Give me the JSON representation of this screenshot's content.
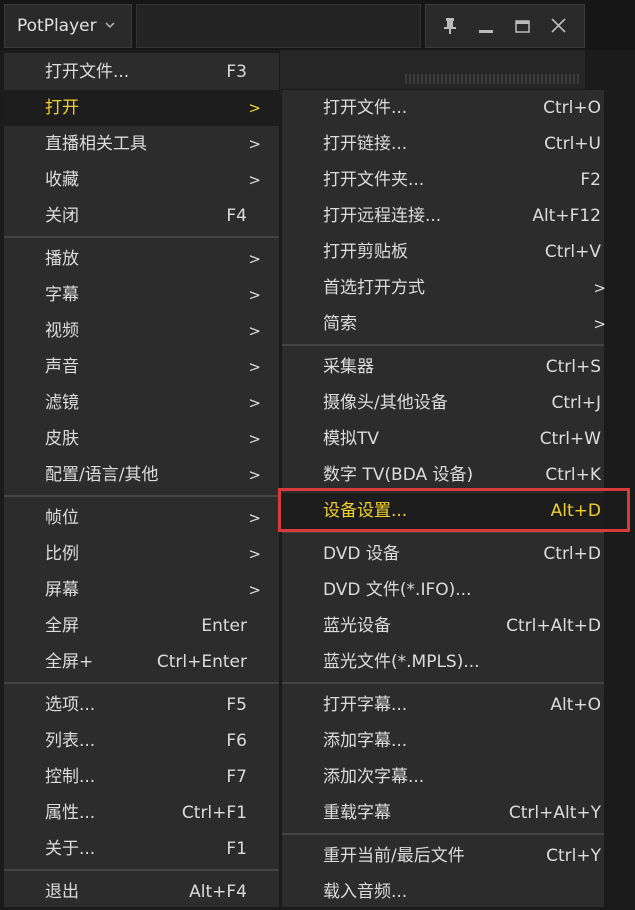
{
  "app": {
    "title": "PotPlayer",
    "chevron_icon": "chevron-down-icon"
  },
  "window_controls": {
    "pin_icon": "pin-icon",
    "minimize_icon": "minimize-icon",
    "maximize_icon": "maximize-icon",
    "close_icon": "close-icon"
  },
  "colors": {
    "active_text": "#f2d12b",
    "highlight_border": "#d93a3a",
    "menu_bg": "#2c2c2c"
  },
  "main_menu": {
    "items": [
      {
        "label": "打开文件...",
        "key": "F3",
        "arrow": ""
      },
      {
        "label": "打开",
        "key": "",
        "arrow": ">"
      },
      {
        "label": "直播相关工具",
        "key": "",
        "arrow": ">"
      },
      {
        "label": "收藏",
        "key": "",
        "arrow": ">"
      },
      {
        "label": "关闭",
        "key": "F4",
        "arrow": ""
      },
      {
        "label": "播放",
        "key": "",
        "arrow": ">"
      },
      {
        "label": "字幕",
        "key": "",
        "arrow": ">"
      },
      {
        "label": "视频",
        "key": "",
        "arrow": ">"
      },
      {
        "label": "声音",
        "key": "",
        "arrow": ">"
      },
      {
        "label": "滤镜",
        "key": "",
        "arrow": ">"
      },
      {
        "label": "皮肤",
        "key": "",
        "arrow": ">"
      },
      {
        "label": "配置/语言/其他",
        "key": "",
        "arrow": ">"
      },
      {
        "label": "帧位",
        "key": "",
        "arrow": ">"
      },
      {
        "label": "比例",
        "key": "",
        "arrow": ">"
      },
      {
        "label": "屏幕",
        "key": "",
        "arrow": ">"
      },
      {
        "label": "全屏",
        "key": "Enter",
        "arrow": ""
      },
      {
        "label": "全屏+",
        "key": "Ctrl+Enter",
        "arrow": ""
      },
      {
        "label": "选项...",
        "key": "F5",
        "arrow": ""
      },
      {
        "label": "列表...",
        "key": "F6",
        "arrow": ""
      },
      {
        "label": "控制...",
        "key": "F7",
        "arrow": ""
      },
      {
        "label": "属性...",
        "key": "Ctrl+F1",
        "arrow": ""
      },
      {
        "label": "关于...",
        "key": "F1",
        "arrow": ""
      },
      {
        "label": "退出",
        "key": "Alt+F4",
        "arrow": ""
      }
    ]
  },
  "sub_menu": {
    "items": [
      {
        "label": "打开文件...",
        "key": "Ctrl+O",
        "arrow": ""
      },
      {
        "label": "打开链接...",
        "key": "Ctrl+U",
        "arrow": ""
      },
      {
        "label": "打开文件夹...",
        "key": "F2",
        "arrow": ""
      },
      {
        "label": "打开远程连接...",
        "key": "Alt+F12",
        "arrow": ""
      },
      {
        "label": "打开剪贴板",
        "key": "Ctrl+V",
        "arrow": ""
      },
      {
        "label": "首选打开方式",
        "key": "",
        "arrow": ">"
      },
      {
        "label": "简索",
        "key": "",
        "arrow": ">"
      },
      {
        "label": "采集器",
        "key": "Ctrl+S",
        "arrow": ""
      },
      {
        "label": "摄像头/其他设备",
        "key": "Ctrl+J",
        "arrow": ""
      },
      {
        "label": "模拟TV",
        "key": "Ctrl+W",
        "arrow": ""
      },
      {
        "label": "数字 TV(BDA 设备)",
        "key": "Ctrl+K",
        "arrow": ""
      },
      {
        "label": "设备设置...",
        "key": "Alt+D",
        "arrow": ""
      },
      {
        "label": "DVD 设备",
        "key": "Ctrl+D",
        "arrow": ""
      },
      {
        "label": "DVD 文件(*.IFO)...",
        "key": "",
        "arrow": ""
      },
      {
        "label": "蓝光设备",
        "key": "Ctrl+Alt+D",
        "arrow": ""
      },
      {
        "label": "蓝光文件(*.MPLS)...",
        "key": "",
        "arrow": ""
      },
      {
        "label": "打开字幕...",
        "key": "Alt+O",
        "arrow": ""
      },
      {
        "label": "添加字幕...",
        "key": "",
        "arrow": ""
      },
      {
        "label": "添加次字幕...",
        "key": "",
        "arrow": ""
      },
      {
        "label": "重载字幕",
        "key": "Ctrl+Alt+Y",
        "arrow": ""
      },
      {
        "label": "重开当前/最后文件",
        "key": "Ctrl+Y",
        "arrow": ""
      },
      {
        "label": "载入音频...",
        "key": "",
        "arrow": ""
      }
    ]
  }
}
